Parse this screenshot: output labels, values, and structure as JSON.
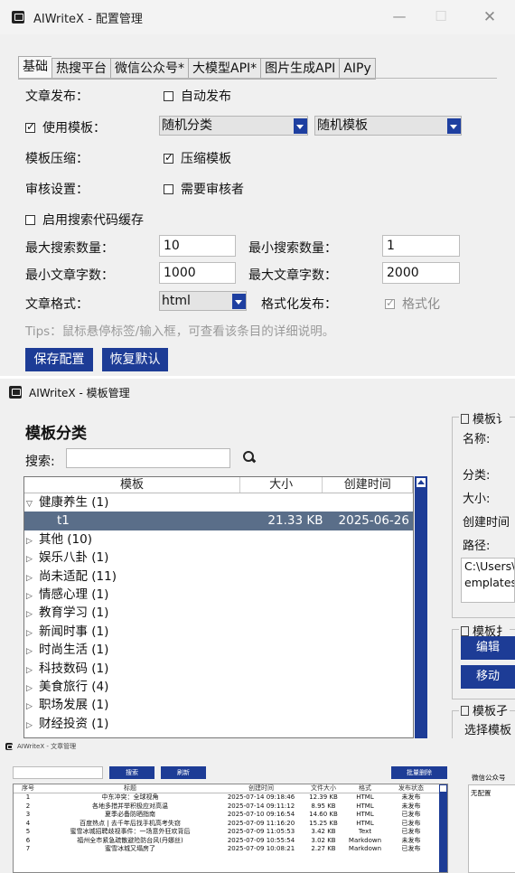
{
  "config_window": {
    "title": "AIWriteX - 配置管理",
    "controls": {
      "minimize": "—",
      "maximize": "☐",
      "close": "✕"
    },
    "tabs": [
      "基础",
      "热搜平台",
      "微信公众号*",
      "大模型API*",
      "图片生成API",
      "AIPy"
    ],
    "active_tab": 0,
    "publish": {
      "label": "文章发布：",
      "auto_publish": "自动发布",
      "auto_publish_checked": false
    },
    "template": {
      "use_template": "使用模板：",
      "use_template_checked": true,
      "category": "随机分类",
      "template": "随机模板"
    },
    "compress": {
      "label": "模板压缩：",
      "option": "压缩模板",
      "checked": true
    },
    "review": {
      "label": "审核设置：",
      "option": "需要审核者",
      "checked": false
    },
    "cache": {
      "option": "启用搜索代码缓存",
      "checked": false
    },
    "max_search": {
      "label": "最大搜索数量：",
      "value": "10"
    },
    "min_search": {
      "label": "最小搜索数量：",
      "value": "1"
    },
    "min_words": {
      "label": "最小文章字数：",
      "value": "1000"
    },
    "max_words": {
      "label": "最大文章字数：",
      "value": "2000"
    },
    "format": {
      "label": "文章格式：",
      "value": "html",
      "fmt_publish_label": "格式化发布：",
      "fmt_option": "格式化",
      "fmt_checked": true
    },
    "tips": "Tips：鼠标悬停标签/输入框，可查看该条目的详细说明。",
    "buttons": {
      "save": "保存配置",
      "restore": "恢复默认"
    }
  },
  "template_window": {
    "title": "AIWriteX - 模板管理",
    "section_title": "模板分类",
    "search_label": "搜索:",
    "columns": [
      "模板",
      "大小",
      "创建时间"
    ],
    "rows": [
      {
        "toggle": "▽",
        "name": "健康养生 (1)",
        "size": "",
        "time": "",
        "indent": 0,
        "selected": false
      },
      {
        "toggle": "",
        "name": "t1",
        "size": "21.33 KB",
        "time": "2025-06-26",
        "indent": 1,
        "selected": true
      },
      {
        "toggle": "▷",
        "name": "其他 (10)",
        "size": "",
        "time": "",
        "indent": 0,
        "selected": false
      },
      {
        "toggle": "▷",
        "name": "娱乐八卦 (1)",
        "size": "",
        "time": "",
        "indent": 0,
        "selected": false
      },
      {
        "toggle": "▷",
        "name": "尚未适配 (11)",
        "size": "",
        "time": "",
        "indent": 0,
        "selected": false
      },
      {
        "toggle": "▷",
        "name": "情感心理 (1)",
        "size": "",
        "time": "",
        "indent": 0,
        "selected": false
      },
      {
        "toggle": "▷",
        "name": "教育学习 (1)",
        "size": "",
        "time": "",
        "indent": 0,
        "selected": false
      },
      {
        "toggle": "▷",
        "name": "新闻时事 (1)",
        "size": "",
        "time": "",
        "indent": 0,
        "selected": false
      },
      {
        "toggle": "▷",
        "name": "时尚生活 (1)",
        "size": "",
        "time": "",
        "indent": 0,
        "selected": false
      },
      {
        "toggle": "▷",
        "name": "科技数码 (1)",
        "size": "",
        "time": "",
        "indent": 0,
        "selected": false
      },
      {
        "toggle": "▷",
        "name": "美食旅行 (4)",
        "size": "",
        "time": "",
        "indent": 0,
        "selected": false
      },
      {
        "toggle": "▷",
        "name": "职场发展 (1)",
        "size": "",
        "time": "",
        "indent": 0,
        "selected": false
      },
      {
        "toggle": "▷",
        "name": "财经投资 (1)",
        "size": "",
        "time": "",
        "indent": 0,
        "selected": false
      }
    ],
    "info": {
      "frame_title": "模板讠",
      "name_label": "名称:",
      "category_label": "分类:",
      "size_label": "大小:",
      "time_label": "创建时间",
      "path_label": "路径:",
      "path_value_1": "C:\\Users\\",
      "path_value_2": "emplates"
    },
    "ops": {
      "frame_title": "模板扌",
      "edit": "编辑",
      "move": "移动"
    },
    "select": {
      "frame_title": "模板孑",
      "label": "选择模板"
    }
  },
  "article_window": {
    "title": "AIWriteX - 文章管理",
    "buttons": {
      "search": "搜索",
      "refresh": "刷新",
      "batch_delete": "批量删除"
    },
    "columns": [
      "序号",
      "标题",
      "创建时间",
      "文件大小",
      "格式",
      "发布状态"
    ],
    "rows": [
      [
        "1",
        "中东冲突：全球视角",
        "2025-07-14 09:18:46",
        "12.39 KB",
        "HTML",
        "未发布"
      ],
      [
        "2",
        "各地多措并举积极应对高温",
        "2025-07-14 09:11:12",
        "8.95 KB",
        "HTML",
        "未发布"
      ],
      [
        "3",
        "夏季必备防晒指南",
        "2025-07-10 09:16:54",
        "14.60 KB",
        "HTML",
        "已发布"
      ],
      [
        "4",
        "百度热点 | 去千年后找手机高考失窃",
        "2025-07-09 11:16:20",
        "15.25 KB",
        "HTML",
        "已发布"
      ],
      [
        "5",
        "蜜雪冰城招聘歧视事件：一场意外狂欢背后",
        "2025-07-09 11:05:53",
        "3.42 KB",
        "Text",
        "已发布"
      ],
      [
        "6",
        "福州全市紧急疏散避险防台风(丹娜丝)",
        "2025-07-09 10:55:54",
        "3.02 KB",
        "Markdown",
        "未发布"
      ],
      [
        "7",
        "蜜雪冰城又塌房了",
        "2025-07-09 10:08:21",
        "2.27 KB",
        "Markdown",
        "已发布"
      ]
    ],
    "wechat_label": "微信公众号",
    "wechat_value": "无配置"
  }
}
